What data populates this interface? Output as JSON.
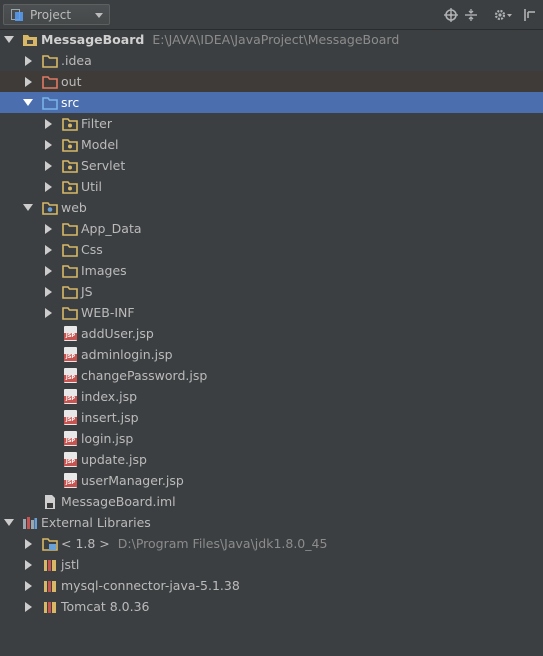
{
  "toolbar": {
    "view_label": "Project",
    "icons": [
      "locate-icon",
      "collapse-all-icon",
      "settings-icon",
      "hide-panel-icon"
    ]
  },
  "tree": {
    "project": {
      "name": "MessageBoard",
      "path": "E:\\JAVA\\IDEA\\JavaProject\\MessageBoard"
    },
    "idea": ".idea",
    "out": "out",
    "src": "src",
    "src_children": [
      "Filter",
      "Model",
      "Servlet",
      "Util"
    ],
    "web": "web",
    "web_folders": [
      "App_Data",
      "Css",
      "Images",
      "JS",
      "WEB-INF"
    ],
    "web_files": [
      "addUser.jsp",
      "adminlogin.jsp",
      "changePassword.jsp",
      "index.jsp",
      "insert.jsp",
      "login.jsp",
      "update.jsp",
      "userManager.jsp"
    ],
    "iml": "MessageBoard.iml",
    "external": "External Libraries",
    "jdk": {
      "name": "< 1.8 >",
      "path": "D:\\Program Files\\Java\\jdk1.8.0_45"
    },
    "libs": [
      "jstl",
      "mysql-connector-java-5.1.38",
      "Tomcat 8.0.36"
    ]
  },
  "colors": {
    "background": "#3c3f41",
    "selection": "#4b6eaf",
    "folder": "#d8b867",
    "source_folder": "#7ab3e8",
    "excluded_folder": "#e07a64"
  }
}
